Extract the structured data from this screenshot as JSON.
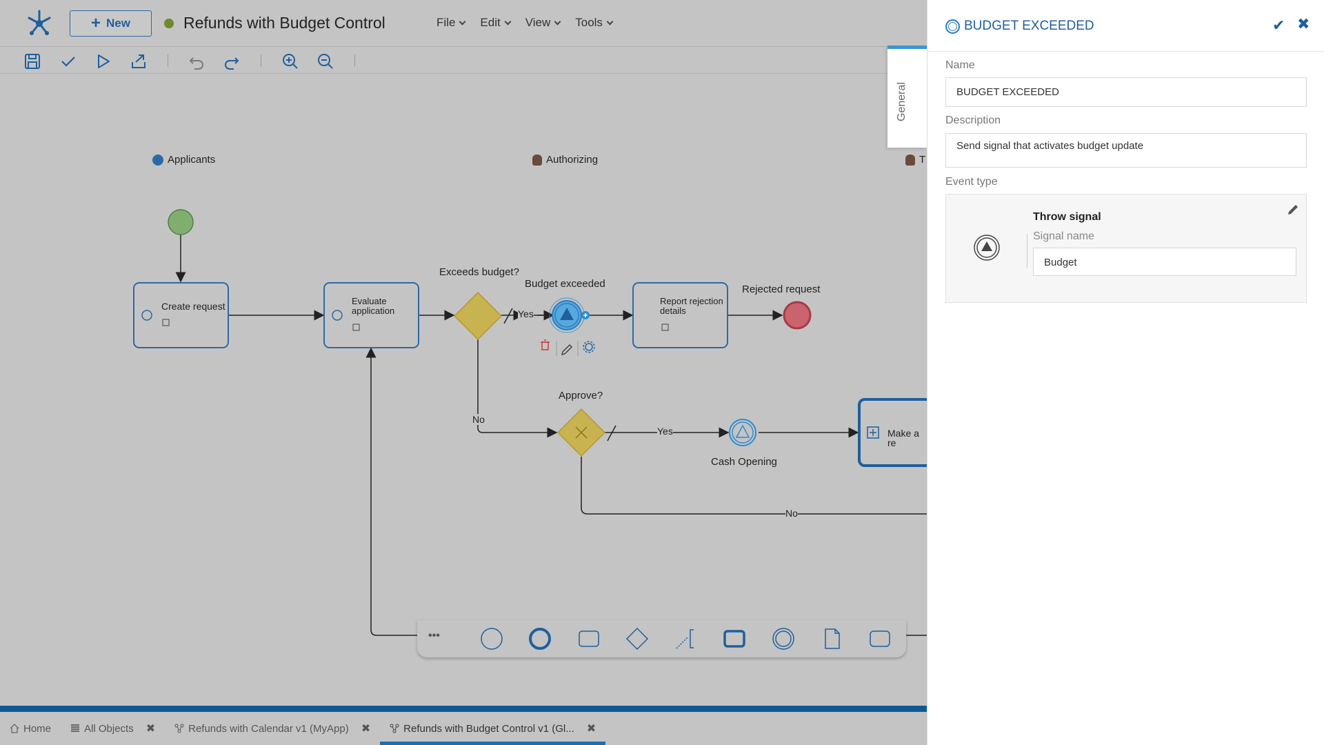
{
  "app": {
    "new_label": "New",
    "doc_title": "Refunds with Budget Control",
    "menu": [
      "File",
      "Edit",
      "View",
      "Tools"
    ]
  },
  "toolbar": {
    "icons": [
      "save-icon",
      "validate-icon",
      "run-icon",
      "publish-icon",
      "undo-icon",
      "redo-icon",
      "zoom-in-icon",
      "zoom-out-icon"
    ]
  },
  "diagram": {
    "lanes": [
      "Applicants",
      "Authorizing",
      "T"
    ],
    "tasks": {
      "create_request": "Create request",
      "evaluate_application": "Evaluate application",
      "report_rejection": "Report rejection details",
      "make_a": "Make a re"
    },
    "gateways": {
      "exceeds_budget": "Exceeds budget?",
      "approve": "Approve?"
    },
    "events": {
      "budget_exceeded": "Budget exceeded",
      "rejected_request": "Rejected request",
      "cash_opening": "Cash Opening"
    },
    "flow_labels": {
      "yes1": "Yes",
      "no1": "No",
      "yes2": "Yes",
      "no2": "No"
    },
    "palette_more": "•••"
  },
  "tabs": [
    {
      "label": "Home",
      "icon": "home-icon",
      "closable": false
    },
    {
      "label": "All Objects",
      "icon": "list-icon",
      "closable": true
    },
    {
      "label": "Refunds with Calendar v1 (MyApp)",
      "icon": "process-icon",
      "closable": true
    },
    {
      "label": "Refunds with Budget Control v1 (Gl...",
      "icon": "process-icon",
      "closable": true,
      "active": true
    }
  ],
  "panel": {
    "side_tab": "General",
    "title": "BUDGET EXCEEDED",
    "name_label": "Name",
    "name_value": "BUDGET EXCEEDED",
    "description_label": "Description",
    "description_value": "Send signal that activates budget update",
    "event_type_label": "Event type",
    "event_type_title": "Throw signal",
    "signal_name_label": "Signal name",
    "signal_name_value": "Budget"
  },
  "colors": {
    "accent": "#1f5f9c",
    "canvas_bg": "#c4c4c4",
    "gateway": "#c9b250",
    "start_event": "#7fae6f",
    "end_event": "#c9646e",
    "active_tab": "#1f6fb0"
  }
}
